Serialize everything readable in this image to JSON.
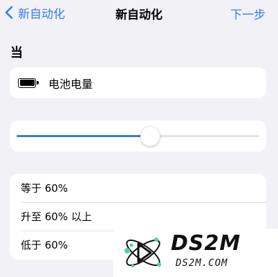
{
  "navbar": {
    "back_label": "新自动化",
    "title": "新自动化",
    "next_label": "下一步"
  },
  "section": {
    "header": "当"
  },
  "trigger": {
    "icon": "battery-icon",
    "label": "电池电量"
  },
  "slider": {
    "value_fraction": 0.55
  },
  "options": [
    {
      "label": "等于 60%"
    },
    {
      "label": "升至 60% 以上"
    },
    {
      "label": "低于 60%"
    }
  ],
  "watermark": {
    "main": "DS2M",
    "sub": "DS2M.COM"
  },
  "colors": {
    "accent": "#2f7cf6",
    "background": "#f2f2f6",
    "card": "#ffffff",
    "separator": "#e2e2e6"
  }
}
